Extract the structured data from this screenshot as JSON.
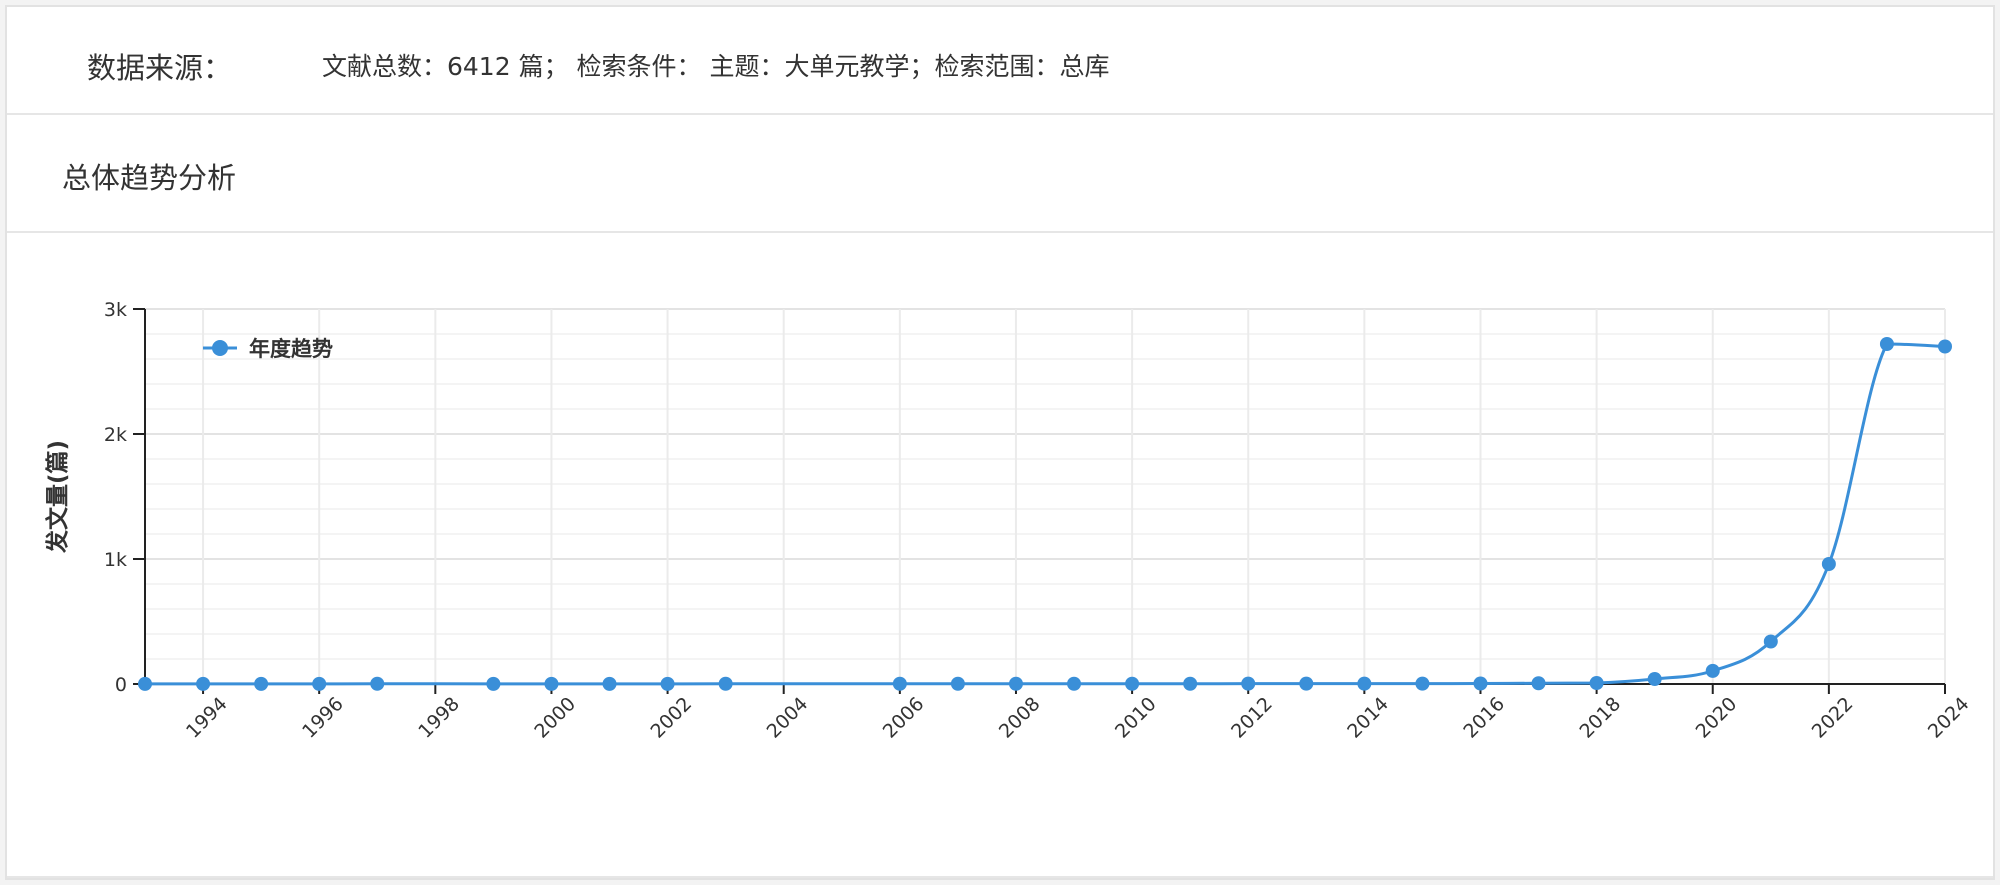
{
  "header": {
    "source_label": "数据来源：",
    "source_info": "文献总数：6412 篇； 检索条件： 主题：大单元教学；检索范围：总库"
  },
  "section": {
    "title": "总体趋势分析"
  },
  "chart_data": {
    "type": "line",
    "ylabel": "发文量(篇)",
    "ylim": [
      0,
      3000
    ],
    "yticks": [
      0,
      1000,
      2000,
      3000
    ],
    "ytick_labels": [
      "0",
      "1k",
      "2k",
      "3k"
    ],
    "xticks": [
      1994,
      1996,
      1998,
      2000,
      2002,
      2004,
      2006,
      2008,
      2010,
      2012,
      2014,
      2016,
      2018,
      2020,
      2022,
      2024
    ],
    "xlim": [
      1993,
      2024
    ],
    "grid": true,
    "legend_position": "top-left",
    "series": [
      {
        "name": "年度趋势",
        "color": "#3a8fd8",
        "points": [
          [
            1993,
            1
          ],
          [
            1994,
            1
          ],
          [
            1995,
            1
          ],
          [
            1996,
            1
          ],
          [
            1997,
            2
          ],
          [
            1999,
            1
          ],
          [
            2000,
            1
          ],
          [
            2001,
            1
          ],
          [
            2002,
            1
          ],
          [
            2003,
            2
          ],
          [
            2006,
            2
          ],
          [
            2007,
            2
          ],
          [
            2008,
            2
          ],
          [
            2009,
            2
          ],
          [
            2010,
            2
          ],
          [
            2011,
            2
          ],
          [
            2012,
            3
          ],
          [
            2013,
            3
          ],
          [
            2014,
            3
          ],
          [
            2015,
            3
          ],
          [
            2016,
            4
          ],
          [
            2017,
            6
          ],
          [
            2018,
            8
          ],
          [
            2019,
            40
          ],
          [
            2020,
            105
          ],
          [
            2021,
            340
          ],
          [
            2022,
            960
          ],
          [
            2023,
            2720
          ],
          [
            2024,
            2700
          ]
        ]
      }
    ]
  }
}
